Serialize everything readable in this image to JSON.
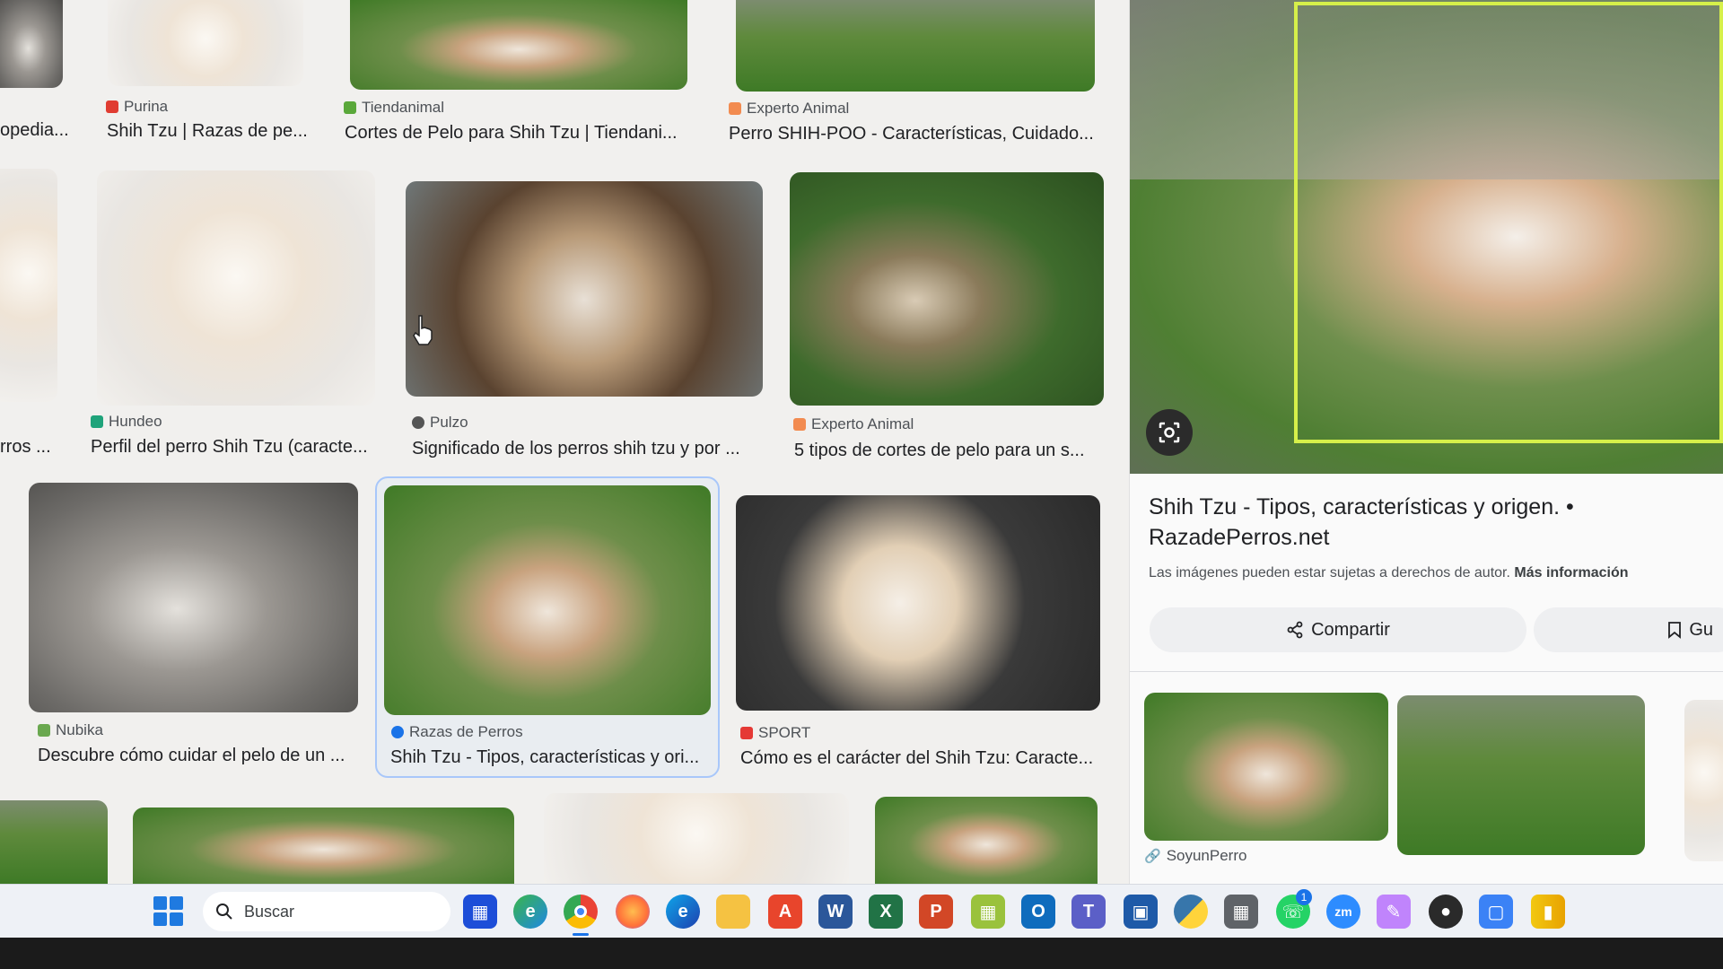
{
  "results": {
    "row1": [
      {
        "source": "",
        "title": "opedia..."
      },
      {
        "source": "Purina",
        "title": "Shih Tzu | Razas de pe..."
      },
      {
        "source": "Tiendanimal",
        "title": "Cortes de Pelo para Shih Tzu | Tiendani..."
      },
      {
        "source": "Experto Animal",
        "title": "Perro SHIH-POO - Características, Cuidado..."
      }
    ],
    "row2": [
      {
        "source": "",
        "title": "rros ..."
      },
      {
        "source": "Hundeo",
        "title": "Perfil del perro Shih Tzu (caracte..."
      },
      {
        "source": "Pulzo",
        "title": "Significado de los perros shih tzu y por ..."
      },
      {
        "source": "Experto Animal",
        "title": "5 tipos de cortes de pelo para un s..."
      }
    ],
    "row3": [
      {
        "source": "Nubika",
        "title": "Descubre cómo cuidar el pelo de un ..."
      },
      {
        "source": "Razas de Perros",
        "title": "Shih Tzu - Tipos, características y ori..."
      },
      {
        "source": "SPORT",
        "title": "Cómo es el carácter del Shih Tzu: Caracte..."
      }
    ]
  },
  "panel": {
    "title": "Shih Tzu - Tipos, características y origen. • RazadePerros.net",
    "rights_note": "Las imágenes pueden estar sujetas a derechos de autor.",
    "more_info": "Más información",
    "share_label": "Compartir",
    "save_label": "Gu",
    "related_source": "SoyunPerro"
  },
  "taskbar": {
    "search_placeholder": "Buscar",
    "apps": [
      "File Explorer",
      "Edge",
      "Chrome",
      "Firefox",
      "Edge",
      "Files",
      "Acrobat",
      "Word",
      "Excel",
      "PowerPoint",
      "Snip",
      "Outlook",
      "Teams",
      "Remote",
      "Python",
      "Calculator",
      "WhatsApp",
      "Zoom",
      "Paint",
      "Cursor",
      "Store",
      "Power BI"
    ],
    "whatsapp_badge": "1"
  },
  "colors": {
    "lens_border": "#d6f04a",
    "accent": "#1a73e8"
  }
}
